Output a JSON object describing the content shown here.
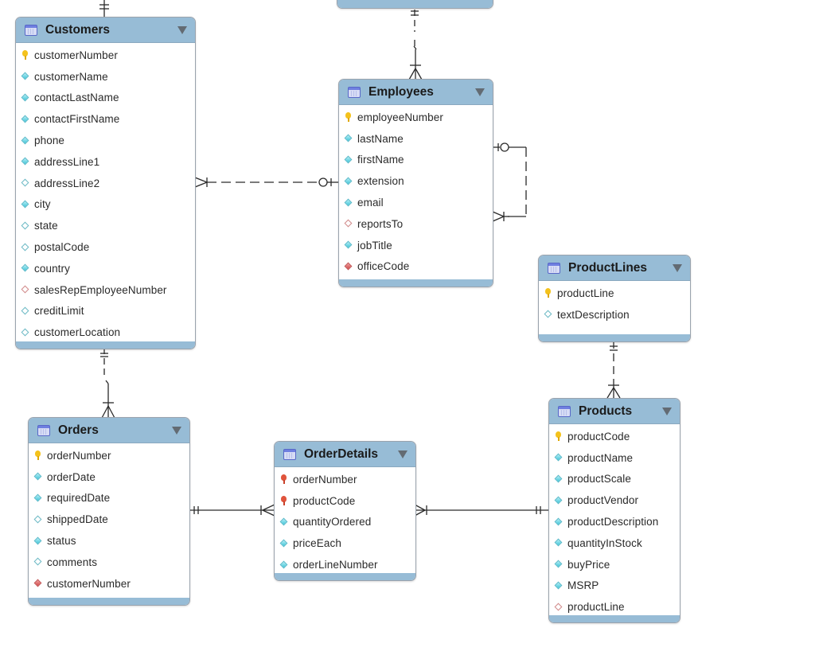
{
  "diagram": {
    "type": "EER diagram",
    "entities": [
      {
        "id": "customers",
        "title": "Customers",
        "columns": [
          {
            "name": "customerNumber",
            "kind": "pk"
          },
          {
            "name": "customerName",
            "kind": "not-null"
          },
          {
            "name": "contactLastName",
            "kind": "not-null"
          },
          {
            "name": "contactFirstName",
            "kind": "not-null"
          },
          {
            "name": "phone",
            "kind": "not-null"
          },
          {
            "name": "addressLine1",
            "kind": "not-null"
          },
          {
            "name": "addressLine2",
            "kind": "nullable"
          },
          {
            "name": "city",
            "kind": "not-null"
          },
          {
            "name": "state",
            "kind": "nullable"
          },
          {
            "name": "postalCode",
            "kind": "nullable"
          },
          {
            "name": "country",
            "kind": "not-null"
          },
          {
            "name": "salesRepEmployeeNumber",
            "kind": "fk-nullable"
          },
          {
            "name": "creditLimit",
            "kind": "nullable"
          },
          {
            "name": "customerLocation",
            "kind": "nullable"
          }
        ]
      },
      {
        "id": "employees",
        "title": "Employees",
        "columns": [
          {
            "name": "employeeNumber",
            "kind": "pk"
          },
          {
            "name": "lastName",
            "kind": "not-null"
          },
          {
            "name": "firstName",
            "kind": "not-null"
          },
          {
            "name": "extension",
            "kind": "not-null"
          },
          {
            "name": "email",
            "kind": "not-null"
          },
          {
            "name": "reportsTo",
            "kind": "fk-nullable"
          },
          {
            "name": "jobTitle",
            "kind": "not-null"
          },
          {
            "name": "officeCode",
            "kind": "fk-not-null"
          }
        ]
      },
      {
        "id": "productlines",
        "title": "ProductLines",
        "columns": [
          {
            "name": "productLine",
            "kind": "pk"
          },
          {
            "name": "textDescription",
            "kind": "nullable"
          }
        ]
      },
      {
        "id": "orders",
        "title": "Orders",
        "columns": [
          {
            "name": "orderNumber",
            "kind": "pk"
          },
          {
            "name": "orderDate",
            "kind": "not-null"
          },
          {
            "name": "requiredDate",
            "kind": "not-null"
          },
          {
            "name": "shippedDate",
            "kind": "nullable"
          },
          {
            "name": "status",
            "kind": "not-null"
          },
          {
            "name": "comments",
            "kind": "nullable"
          },
          {
            "name": "customerNumber",
            "kind": "fk-not-null"
          }
        ]
      },
      {
        "id": "orderdetails",
        "title": "OrderDetails",
        "columns": [
          {
            "name": "orderNumber",
            "kind": "pk-fk"
          },
          {
            "name": "productCode",
            "kind": "pk-fk"
          },
          {
            "name": "quantityOrdered",
            "kind": "not-null"
          },
          {
            "name": "priceEach",
            "kind": "not-null"
          },
          {
            "name": "orderLineNumber",
            "kind": "not-null"
          }
        ]
      },
      {
        "id": "products",
        "title": "Products",
        "columns": [
          {
            "name": "productCode",
            "kind": "pk"
          },
          {
            "name": "productName",
            "kind": "not-null"
          },
          {
            "name": "productScale",
            "kind": "not-null"
          },
          {
            "name": "productVendor",
            "kind": "not-null"
          },
          {
            "name": "productDescription",
            "kind": "not-null"
          },
          {
            "name": "quantityInStock",
            "kind": "not-null"
          },
          {
            "name": "buyPrice",
            "kind": "not-null"
          },
          {
            "name": "MSRP",
            "kind": "not-null"
          },
          {
            "name": "productLine",
            "kind": "fk-nullable"
          }
        ]
      },
      {
        "id": "offices",
        "title": "",
        "columns": []
      }
    ],
    "relationships": [
      {
        "from": "offices",
        "to": "employees",
        "from_card": "one-and-only-one",
        "to_card": "one-or-many",
        "identifying": false
      },
      {
        "from": "employees",
        "to": "customers",
        "from_card": "zero-or-one",
        "to_card": "one-or-many",
        "identifying": false
      },
      {
        "from": "employees",
        "to": "employees",
        "from_card": "zero-or-one",
        "to_card": "one-or-many",
        "identifying": false
      },
      {
        "from": "customers",
        "to": "orders",
        "from_card": "one-and-only-one",
        "to_card": "one-or-many",
        "identifying": false
      },
      {
        "from": "orders",
        "to": "orderdetails",
        "from_card": "one-and-only-one",
        "to_card": "one-or-many",
        "identifying": true
      },
      {
        "from": "products",
        "to": "orderdetails",
        "from_card": "one-and-only-one",
        "to_card": "one-or-many",
        "identifying": true
      },
      {
        "from": "productlines",
        "to": "products",
        "from_card": "one-and-only-one",
        "to_card": "one-or-many",
        "identifying": false
      }
    ],
    "colors": {
      "header": "#97bcd6",
      "pk_key": "#f4c21c",
      "fk_key": "#e0543c",
      "column_diamond": "#3ec4d8",
      "fk_diamond": "#d04848"
    }
  }
}
